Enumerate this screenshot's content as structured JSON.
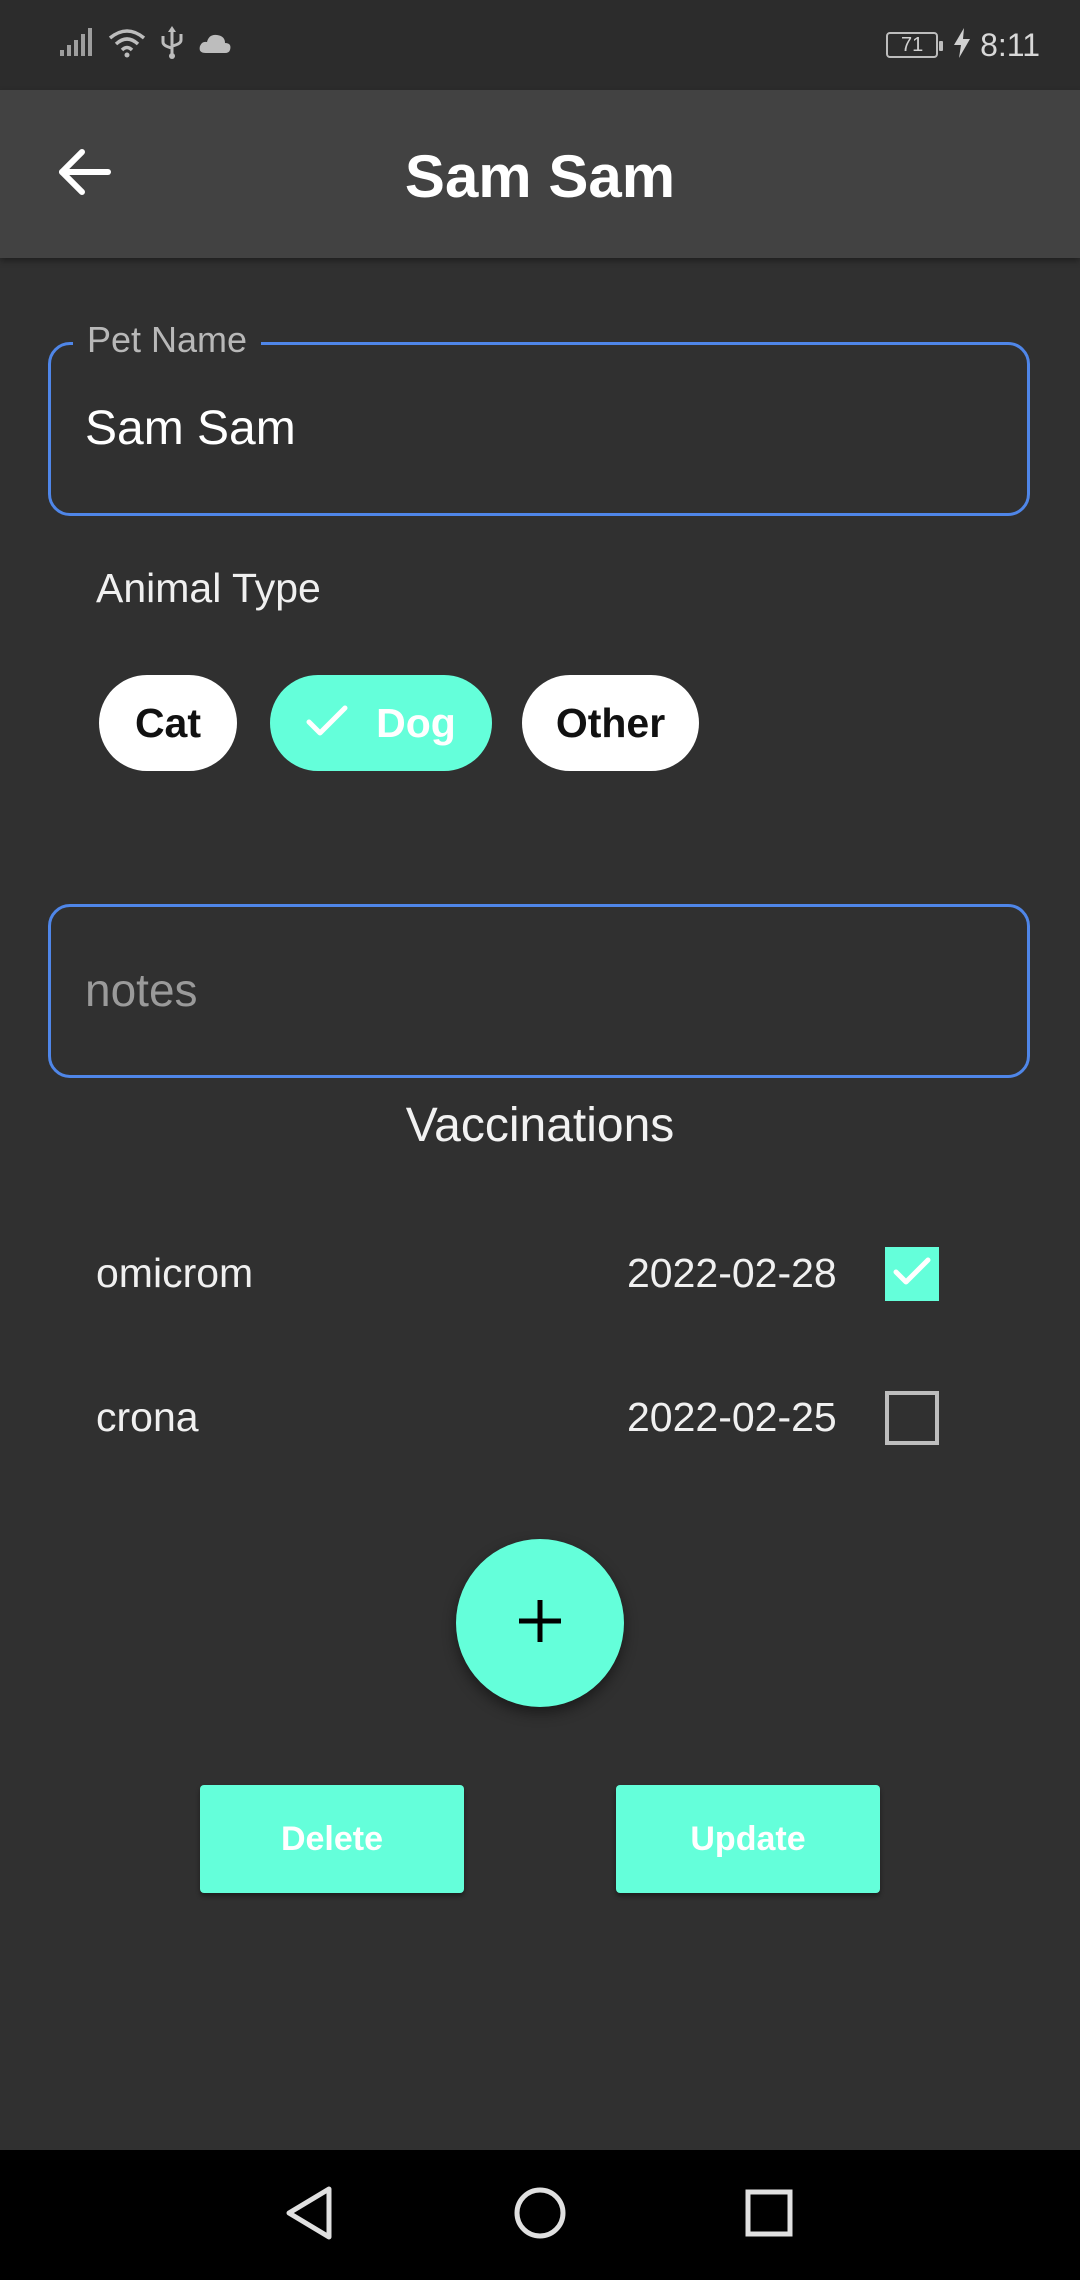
{
  "status_bar": {
    "time": "8:11",
    "battery": "71",
    "icons": [
      "signal-icon",
      "wifi-icon",
      "usb-icon",
      "cloud-icon",
      "battery-icon",
      "charging-icon"
    ]
  },
  "app_bar": {
    "title": "Sam Sam",
    "back_icon": "arrow-back-icon"
  },
  "form": {
    "pet_name": {
      "label": "Pet Name",
      "value": "Sam Sam"
    },
    "animal_type": {
      "label": "Animal Type",
      "options": [
        {
          "label": "Cat",
          "selected": false
        },
        {
          "label": "Dog",
          "selected": true
        },
        {
          "label": "Other",
          "selected": false
        }
      ]
    },
    "notes": {
      "placeholder": "notes",
      "value": ""
    }
  },
  "vaccinations": {
    "title": "Vaccinations",
    "items": [
      {
        "name": "omicrom",
        "date": "2022-02-28",
        "checked": true
      },
      {
        "name": "crona",
        "date": "2022-02-25",
        "checked": false
      }
    ],
    "add_icon": "plus-icon"
  },
  "actions": {
    "delete_label": "Delete",
    "update_label": "Update"
  },
  "colors": {
    "accent": "#64ffda",
    "focus_border": "#4f86e8",
    "background": "#303030",
    "app_bar": "#424242"
  },
  "nav_bar": {
    "icons": [
      "nav-back-icon",
      "nav-home-icon",
      "nav-recents-icon"
    ]
  }
}
